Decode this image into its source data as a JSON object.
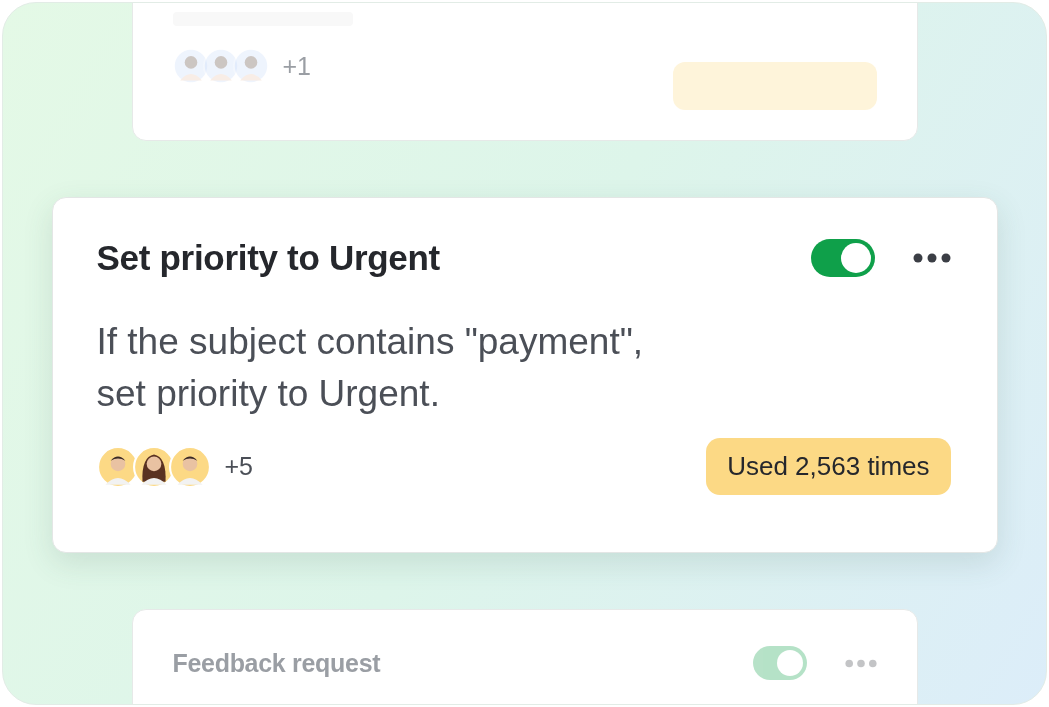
{
  "cards": [
    {
      "kind": "summary",
      "faded": true,
      "avatars": [
        {
          "kind": "woman"
        },
        {
          "kind": "woman"
        },
        {
          "kind": "woman"
        }
      ],
      "more_count": "+1"
    },
    {
      "kind": "rule",
      "faded": false,
      "title": "Set priority to Urgent",
      "on": true,
      "description": "If the subject contains \"payment\",\nset priority to Urgent.",
      "avatars": [
        {
          "kind": "man"
        },
        {
          "kind": "woman"
        },
        {
          "kind": "man"
        }
      ],
      "more_count": "+5",
      "usage": "Used 2,563 times"
    },
    {
      "kind": "header",
      "faded": true,
      "title": "Feedback request",
      "on": true
    }
  ]
}
